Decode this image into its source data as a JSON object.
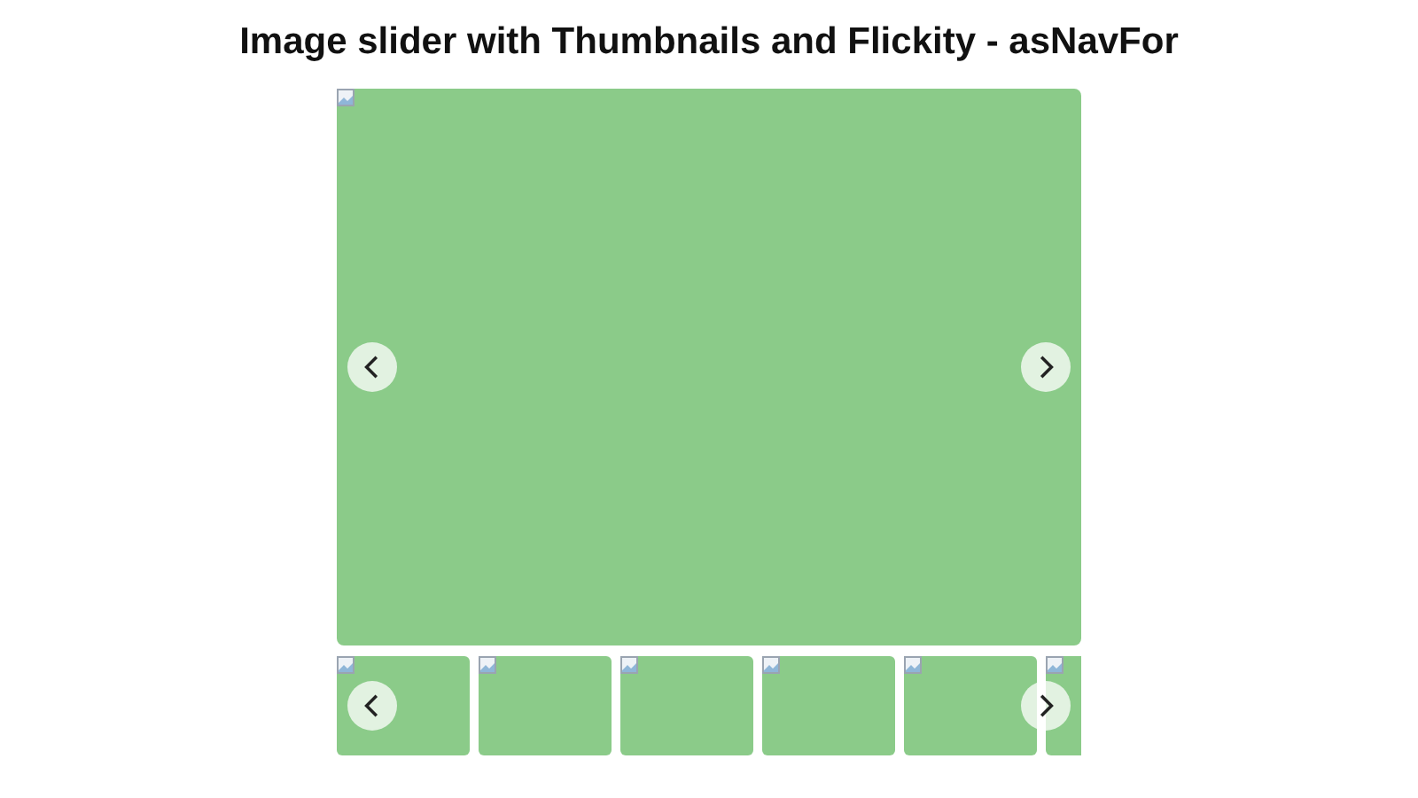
{
  "title": "Image slider with Thumbnails and Flickity - asNavFor",
  "main_slide": {
    "kind": "broken-image"
  },
  "thumbnails": [
    {
      "kind": "broken-image"
    },
    {
      "kind": "broken-image"
    },
    {
      "kind": "broken-image"
    },
    {
      "kind": "broken-image"
    },
    {
      "kind": "broken-image"
    },
    {
      "kind": "broken-image"
    }
  ]
}
